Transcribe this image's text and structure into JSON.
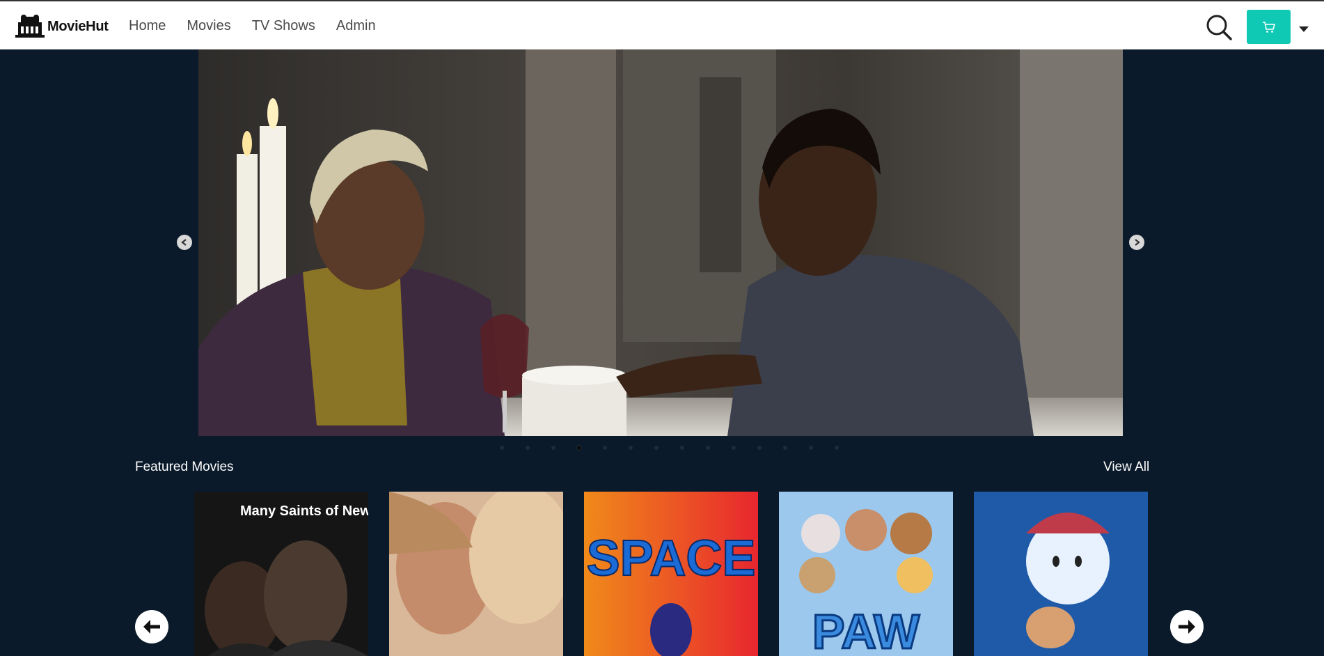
{
  "brand": {
    "name": "MovieHut",
    "logo_icon": "theater-building-icon"
  },
  "nav": {
    "items": [
      "Home",
      "Movies",
      "TV Shows",
      "Admin"
    ]
  },
  "header_actions": {
    "search_icon": "search-icon",
    "cart_icon": "cart-icon",
    "dropdown_icon": "caret-down-icon",
    "cart_color": "#10c9b5"
  },
  "hero": {
    "slide_count": 14,
    "active_slide_index": 3
  },
  "featured": {
    "title": "Featured Movies",
    "view_all": "View All",
    "posters": [
      {
        "title_text": "Many Saints of Newark"
      },
      {
        "title_text": ""
      },
      {
        "title_text": "SPACE"
      },
      {
        "title_text": "PAW"
      },
      {
        "title_text": ""
      }
    ]
  },
  "colors": {
    "page_bg": "#0a1a2a",
    "header_bg": "#ffffff",
    "accent": "#10c9b5"
  }
}
